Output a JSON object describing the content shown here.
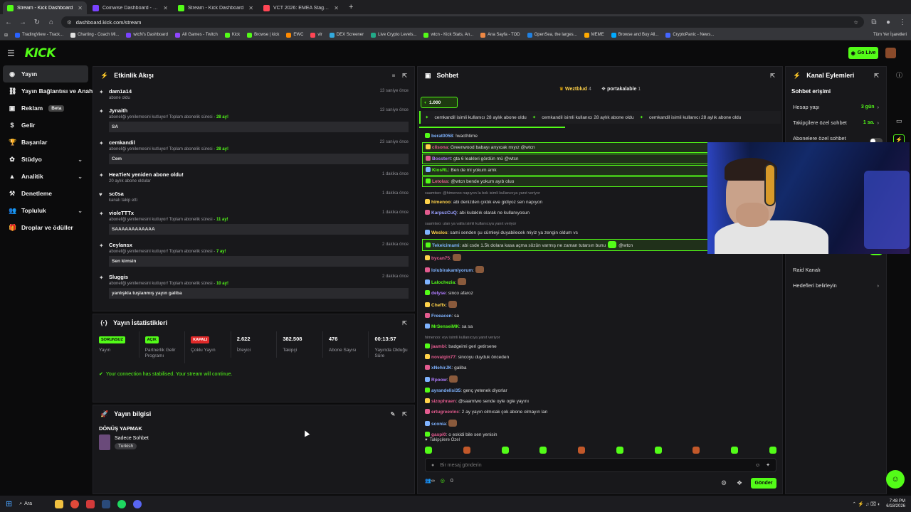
{
  "browser": {
    "tabs": [
      {
        "label": "Stream - Kick Dashboard",
        "color": "#53fc18",
        "active": true
      },
      {
        "label": "Coinwise Dashboard - BTC Cryp",
        "color": "#7a43ff",
        "active": false
      },
      {
        "label": "Stream - Kick Dashboard",
        "color": "#53fc18",
        "active": false
      },
      {
        "label": "VCT 2026: EMEA Stage 2: Brack",
        "color": "#ff4655",
        "active": false
      }
    ],
    "url": "dashboard.kick.com/stream",
    "bookmarks": [
      "TradingView - Track...",
      "Charting - Coach Mi...",
      "wtcN's Dashboard",
      "All Games - Twitch",
      "Kick",
      "Browse | kick",
      "EWC",
      "vlr",
      "DEX Screener",
      "Live Crypto Levels...",
      "wtcn - Kick Stats, An...",
      "Ana Sayfa - TOD",
      "OpenSea, the larges...",
      "MEME",
      "Browse and Buy All...",
      "CryptoPanic - News..."
    ],
    "all_bookmarks": "Tüm Yer İşaretleri"
  },
  "header": {
    "logo": "KICK",
    "go_live": "Go Live"
  },
  "sidebar": {
    "items": [
      {
        "label": "Yayın",
        "icon": "broadcast-icon",
        "active": true
      },
      {
        "label": "Yayın Bağlantısı ve Anahtar",
        "icon": "link-icon"
      },
      {
        "label": "Reklam",
        "icon": "ad-icon",
        "badge": "Beta"
      },
      {
        "label": "Gelir",
        "icon": "dollar-icon"
      },
      {
        "label": "Başarılar",
        "icon": "trophy-icon"
      },
      {
        "label": "Stüdyo",
        "icon": "studio-icon",
        "chevron": true
      },
      {
        "label": "Analitik",
        "icon": "chart-icon",
        "chevron": true
      },
      {
        "label": "Denetleme",
        "icon": "hammer-icon"
      },
      {
        "label": "Topluluk",
        "icon": "community-icon",
        "chevron": true
      },
      {
        "label": "Droplar ve ödüller",
        "icon": "gift-icon"
      }
    ]
  },
  "activity": {
    "title": "Etkinlik Akışı",
    "items": [
      {
        "name": "dam1a14",
        "sub": "abone oldu",
        "time": "13 saniye önce",
        "icon": "star-icon"
      },
      {
        "name": "Jynaith",
        "sub": "aboneliği yenilemesini kutluyor! Toplam abonelik süresi - ",
        "months": "28 ay!",
        "msg": "SA",
        "time": "13 saniye önce",
        "icon": "star-icon"
      },
      {
        "name": "cemkandil",
        "sub": "aboneliği yenilemesini kutluyor! Toplam abonelik süresi - ",
        "months": "28 ay!",
        "msg": "Cem",
        "time": "23 saniye önce",
        "icon": "star-icon"
      },
      {
        "name": "HeaTieN yeniden abone oldu!",
        "sub": "20 aylık abone oldular",
        "time": "1 dakika önce",
        "icon": "star-icon"
      },
      {
        "name": "sc0sa",
        "sub": "kanalı takip etti",
        "time": "1 dakika önce",
        "icon": "heart-icon"
      },
      {
        "name": "violeTTTx",
        "sub": "aboneliği yenilemesini kutluyor! Toplam abonelik süresi - ",
        "months": "11 ay!",
        "msg": "SAAAAAAAAAAAA",
        "time": "1 dakika önce",
        "icon": "star-icon"
      },
      {
        "name": "Ceylansx",
        "sub": "aboneliği yenilemesini kutluyor! Toplam abonelik süresi - ",
        "months": "7 ay!",
        "msg": "Sen kimsin",
        "time": "2 dakika önce",
        "icon": "star-icon"
      },
      {
        "name": "Sluggis",
        "sub": "aboneliği yenilemesini kutluyor! Toplam abonelik süresi - ",
        "months": "10 ay!",
        "msg": "yanlışkla tuşlanmış yayın galiba",
        "time": "2 dakika önce",
        "icon": "star-icon"
      }
    ]
  },
  "stats": {
    "title": "Yayın İstatistikleri",
    "cells": [
      {
        "pill": "SORUNSUZ",
        "pill_color": "#53fc18",
        "label": "Yayın"
      },
      {
        "pill": "AÇIK",
        "pill_color": "#53fc18",
        "label": "Partnerlik Gelir Programı"
      },
      {
        "pill": "KAPALI",
        "pill_color": "#e02929",
        "label": "Çoklu Yayın"
      },
      {
        "value": "2.622",
        "label": "İzleyici"
      },
      {
        "value": "382.508",
        "label": "Takipçi"
      },
      {
        "value": "476",
        "label": "Abone Sayısı"
      },
      {
        "value": "00:13:57",
        "label": "Yayında Olduğu Süre"
      }
    ],
    "notice": "Your connection has stabilised. Your stream will continue."
  },
  "info": {
    "title": "Yayın bilgisi",
    "stream_title": "DÖNÜŞ YAPMAK",
    "category": "Sadece Sohbet",
    "tag": "Turkish"
  },
  "chat": {
    "title": "Sohbet",
    "top_users": [
      {
        "name": "Weztblud",
        "count": "4"
      },
      {
        "name": "portakalable",
        "count": "1"
      }
    ],
    "gift_count": "1.000",
    "ticker": [
      "cemkandil isimli kullanıcı 28 aylık abone oldu",
      "cemkandil isimli kullanıcı 28 aylık abone oldu",
      "cemkandil isimli kullanıcı 28 aylık abone oldu"
    ],
    "messages": [
      {
        "user": "berat0058",
        "color": "#7fb3ff",
        "text": "!wacthtime"
      },
      {
        "user": "clisona",
        "color": "#e35b8f",
        "text": "Greenwood babayı arıyıcak mıyız @wtcn",
        "hl": true
      },
      {
        "user": "Bosstert",
        "color": "#b07cff",
        "text": "gta 6 leakleri gördün mü @wtcn",
        "hl": true
      },
      {
        "user": "KiosRL",
        "color": "#53fc18",
        "text": "Ben de mi yokum amk",
        "hl": true
      },
      {
        "user": "Letolas",
        "color": "#e35b8f",
        "text": "@wtcn bende yokum ayıb oluo",
        "hl": true
      },
      {
        "reply": "saamtwo: @himenoo napıyon la bok isimli kullanıcıya yanıt veriyor",
        "user": "himenoo",
        "color": "#ffd24a",
        "text": "abi denizden çıktık eve gidiyoz sen napıyon"
      },
      {
        "user": "KarpuzCuQ",
        "color": "#9aa0ff",
        "text": "abi kulaklık olarak ne kullanıyosun"
      },
      {
        "reply": "saamtwo: ulan ya valla isimli kullanıcıya yanıt veriyor",
        "user": "Weslos",
        "color": "#ffd24a",
        "text": "sami senden şu cümleyi duyabilecek miyiz ya zengin oldum vs"
      },
      {
        "user": "Tekelcimami",
        "color": "#7fb3ff",
        "text": "abi csde 1.5k dolara kasa açma sözün varmış ne zaman tutarsın bunu",
        "mention": "@wtcn",
        "hl": true
      },
      {
        "user": "bycan75",
        "color": "#e35b8f",
        "text": ""
      },
      {
        "user": "lolubirakamiyorum",
        "color": "#7fb3ff",
        "text": ""
      },
      {
        "user": "Lalochezia",
        "color": "#53fc18",
        "text": ""
      },
      {
        "user": "delyse",
        "color": "#b07cff",
        "text": "sinco afaroz"
      },
      {
        "user": "Cheffx",
        "color": "#ffd24a",
        "text": ""
      },
      {
        "user": "Freeacen",
        "color": "#7fb3ff",
        "text": "sa"
      },
      {
        "user": "MrSenseiMK",
        "color": "#53fc18",
        "text": "sa sa"
      },
      {
        "reply": "himenoo: eyv isimli kullanıcıya yanıt veriyor",
        "user": "jaambi",
        "color": "#e35b8f",
        "text": "badgeimi geri getirsene"
      },
      {
        "user": "novalgin77",
        "color": "#e35b8f",
        "text": "sincoyu duyduk önceden"
      },
      {
        "user": "xNehirJK",
        "color": "#7fb3ff",
        "text": "galiba"
      },
      {
        "user": "Rpoow",
        "color": "#b07cff",
        "text": ""
      },
      {
        "user": "ayrandelisi35",
        "color": "#7fb3ff",
        "text": "genç yetenek diyorlar"
      },
      {
        "user": "sizophraen",
        "color": "#e35b8f",
        "text": "@saamtwo sende oyle ogle yayını"
      },
      {
        "user": "ertugreevinc",
        "color": "#e35b8f",
        "text": "2 ay yayın olmıcak çok abone olmayın lan"
      },
      {
        "user": "sconia",
        "color": "#7fb3ff",
        "text": ""
      },
      {
        "user": "gaspi0",
        "color": "#e35b8f",
        "text": "o eskidi bile sen yenisin"
      }
    ],
    "mode": "Takipçilere Özel",
    "placeholder": "Bir mesaj gönderin",
    "points": "0",
    "send": "Gönder"
  },
  "channel": {
    "title": "Kanal Eylemleri",
    "section": "Sohbet erişimi",
    "items": [
      {
        "label": "Hesap yaşı",
        "value": "3 gün"
      },
      {
        "label": "Takipçilere özel sohbet",
        "value": "1 sa."
      },
      {
        "label": "Abonelere özel sohbet",
        "value": ""
      }
    ],
    "items2": [
      {
        "label": "Raid Kanalı"
      },
      {
        "label": "Hedefleri belirleyin"
      }
    ]
  },
  "taskbar": {
    "search": "Ara",
    "time": "7:48 PM",
    "date": "6/18/2026"
  },
  "colors": {
    "accent": "#53fc18",
    "panel": "#18181b",
    "bg": "#0b0b0c"
  }
}
